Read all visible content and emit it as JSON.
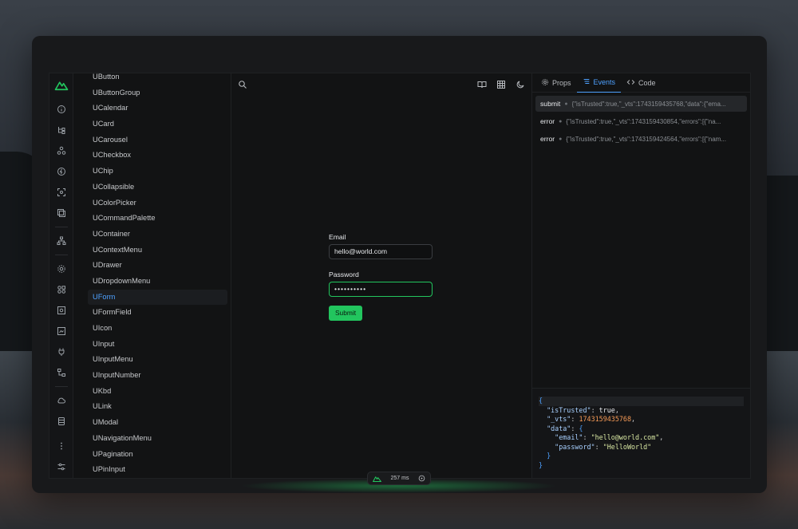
{
  "colors": {
    "accent": "#22c55e",
    "link": "#4ea1ff"
  },
  "components": [
    "UButton",
    "UButtonGroup",
    "UCalendar",
    "UCard",
    "UCarousel",
    "UCheckbox",
    "UChip",
    "UCollapsible",
    "UColorPicker",
    "UCommandPalette",
    "UContainer",
    "UContextMenu",
    "UDrawer",
    "UDropdownMenu",
    "UForm",
    "UFormField",
    "UIcon",
    "UInput",
    "UInputMenu",
    "UInputNumber",
    "UKbd",
    "ULink",
    "UModal",
    "UNavigationMenu",
    "UPagination",
    "UPinInput"
  ],
  "active_component": "UForm",
  "form": {
    "email_label": "Email",
    "email_value": "hello@world.com",
    "password_label": "Password",
    "password_value": "••••••••••",
    "submit_label": "Submit"
  },
  "tabs": [
    {
      "label": "Props",
      "icon": "gear-icon"
    },
    {
      "label": "Events",
      "icon": "list-icon"
    },
    {
      "label": "Code",
      "icon": "code-icon"
    }
  ],
  "events": [
    {
      "name": "submit",
      "payload": "{\"isTrusted\":true,\"_vts\":1743159435768,\"data\":{\"ema..."
    },
    {
      "name": "error",
      "payload": "{\"isTrusted\":true,\"_vts\":1743159430854,\"errors\":[{\"na..."
    },
    {
      "name": "error",
      "payload": "{\"isTrusted\":true,\"_vts\":1743159424564,\"errors\":[{\"nam..."
    }
  ],
  "json_view": {
    "isTrusted_key": "\"isTrusted\"",
    "isTrusted_val": "true",
    "vts_key": "\"_vts\"",
    "vts_val": "1743159435768",
    "data_key": "\"data\"",
    "email_key": "\"email\"",
    "email_val": "\"hello@world.com\"",
    "password_key": "\"password\"",
    "password_val": "\"HelloWorld\""
  },
  "status": {
    "time": "257 ms"
  }
}
